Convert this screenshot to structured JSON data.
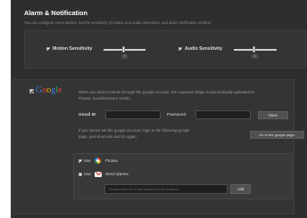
{
  "header": {
    "title": "Alarm & Notification",
    "description": "You can configure event alarms. Set the sensitivity of motion and audio detections, and alarm notification method."
  },
  "sensitivity": {
    "motion": {
      "label": "Motion Sensitivity",
      "checked": true,
      "value": "3",
      "level": 0.6
    },
    "audio": {
      "label": "Audio Sensitivity",
      "checked": true,
      "value": "3",
      "level": 0.6
    }
  },
  "google": {
    "enabled": true,
    "logo_letters": [
      {
        "ch": "G",
        "color": "#3c7df0"
      },
      {
        "ch": "o",
        "color": "#e0433b"
      },
      {
        "ch": "o",
        "color": "#f4b400"
      },
      {
        "ch": "g",
        "color": "#3c7df0"
      },
      {
        "ch": "l",
        "color": "#2aa84a"
      },
      {
        "ch": "e",
        "color": "#e0433b"
      }
    ],
    "description_line1": "When you detect events through the google account, the captured image is automatically uploaded to",
    "description_line2": "Picasa. (nondisclosure mode)",
    "gmail_label": "Gmail ID",
    "gmail_value": "",
    "password_label": "Password",
    "password_value": "",
    "save_label": "Save",
    "help_line1": "If you cannot set the google account, login to the following google",
    "help_line2": "page, permit access and try again.",
    "goto_label": "Go to the google page.",
    "services": {
      "picasa": {
        "use_label": "Use",
        "checked": true,
        "name": "Picasa"
      },
      "gmail": {
        "use_label": "Use",
        "checked": false,
        "name": "Send alarms"
      }
    },
    "recipient_placeholder": "Please enter the email address of the recipient.",
    "add_label": "Add"
  }
}
